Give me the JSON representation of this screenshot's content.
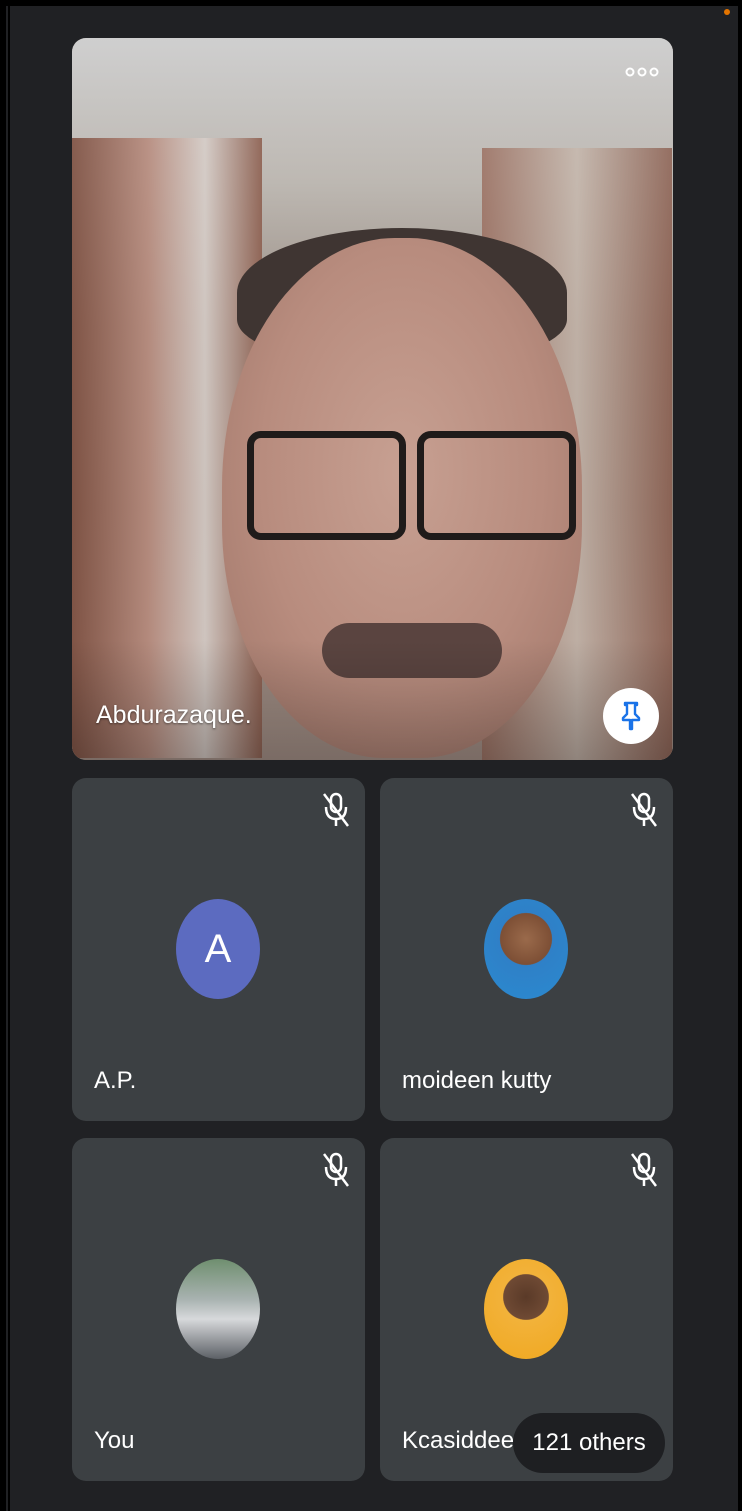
{
  "main_participant": {
    "name": "Abdurazaque.",
    "more_icon": "more-horizontal-icon",
    "pin_icon": "pin-icon"
  },
  "participants": [
    {
      "name": "A.P.",
      "initial": "A",
      "avatar_color": "#5c6bc0",
      "muted": true
    },
    {
      "name": "moideen kutty",
      "muted": true
    },
    {
      "name": "You",
      "muted": true
    },
    {
      "name": "Kcasiddee",
      "muted": true
    }
  ],
  "others_pill": {
    "label": "121 others"
  },
  "colors": {
    "background": "#202124",
    "tile": "#3c4043",
    "accent_dot": "#e37400"
  }
}
